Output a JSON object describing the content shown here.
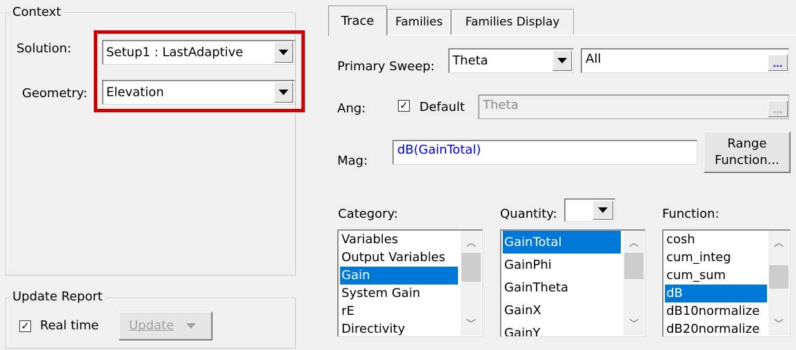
{
  "context": {
    "title": "Context",
    "solution_label": "Solution:",
    "solution_value": "Setup1 : LastAdaptive",
    "geometry_label": "Geometry:",
    "geometry_value": "Elevation",
    "highlight_color": "#cc0000"
  },
  "update_report": {
    "title": "Update Report",
    "realtime_checked": true,
    "realtime_label": "Real time",
    "update_label": "Update"
  },
  "tabs": [
    {
      "label": "Trace",
      "active": true
    },
    {
      "label": "Families",
      "active": false
    },
    {
      "label": "Families Display",
      "active": false
    }
  ],
  "trace": {
    "primary_sweep_label": "Primary Sweep:",
    "primary_sweep_value": "Theta",
    "primary_sweep_range": "All",
    "browse_label": "...",
    "ang_label": "Ang:",
    "default_checked": true,
    "default_label": "Default",
    "ang_value": "Theta",
    "mag_label": "Mag:",
    "mag_value": "dB(GainTotal)",
    "mag_text_color": "#0000ff",
    "range_function_label": "Range Function...",
    "category_label": "Category:",
    "quantity_label": "Quantity:",
    "function_label": "Function:",
    "categories": [
      "Variables",
      "Output Variables",
      "Gain",
      "System Gain",
      "rE",
      "Directivity"
    ],
    "category_selected": "Gain",
    "quantities": [
      "GainTotal",
      "GainPhi",
      "GainTheta",
      "GainX",
      "GainY"
    ],
    "quantity_selected": "GainTotal",
    "functions": [
      "cosh",
      "cum_integ",
      "cum_sum",
      "dB",
      "dB10normalize",
      "dB20normalize"
    ],
    "function_selected": "dB",
    "selection_color": "#0078d7"
  },
  "icons": {
    "dropdown": "chevron-down-icon",
    "scroll_up": "scroll-up-icon",
    "scroll_down": "scroll-down-icon",
    "checkmark": "checkmark-icon"
  }
}
